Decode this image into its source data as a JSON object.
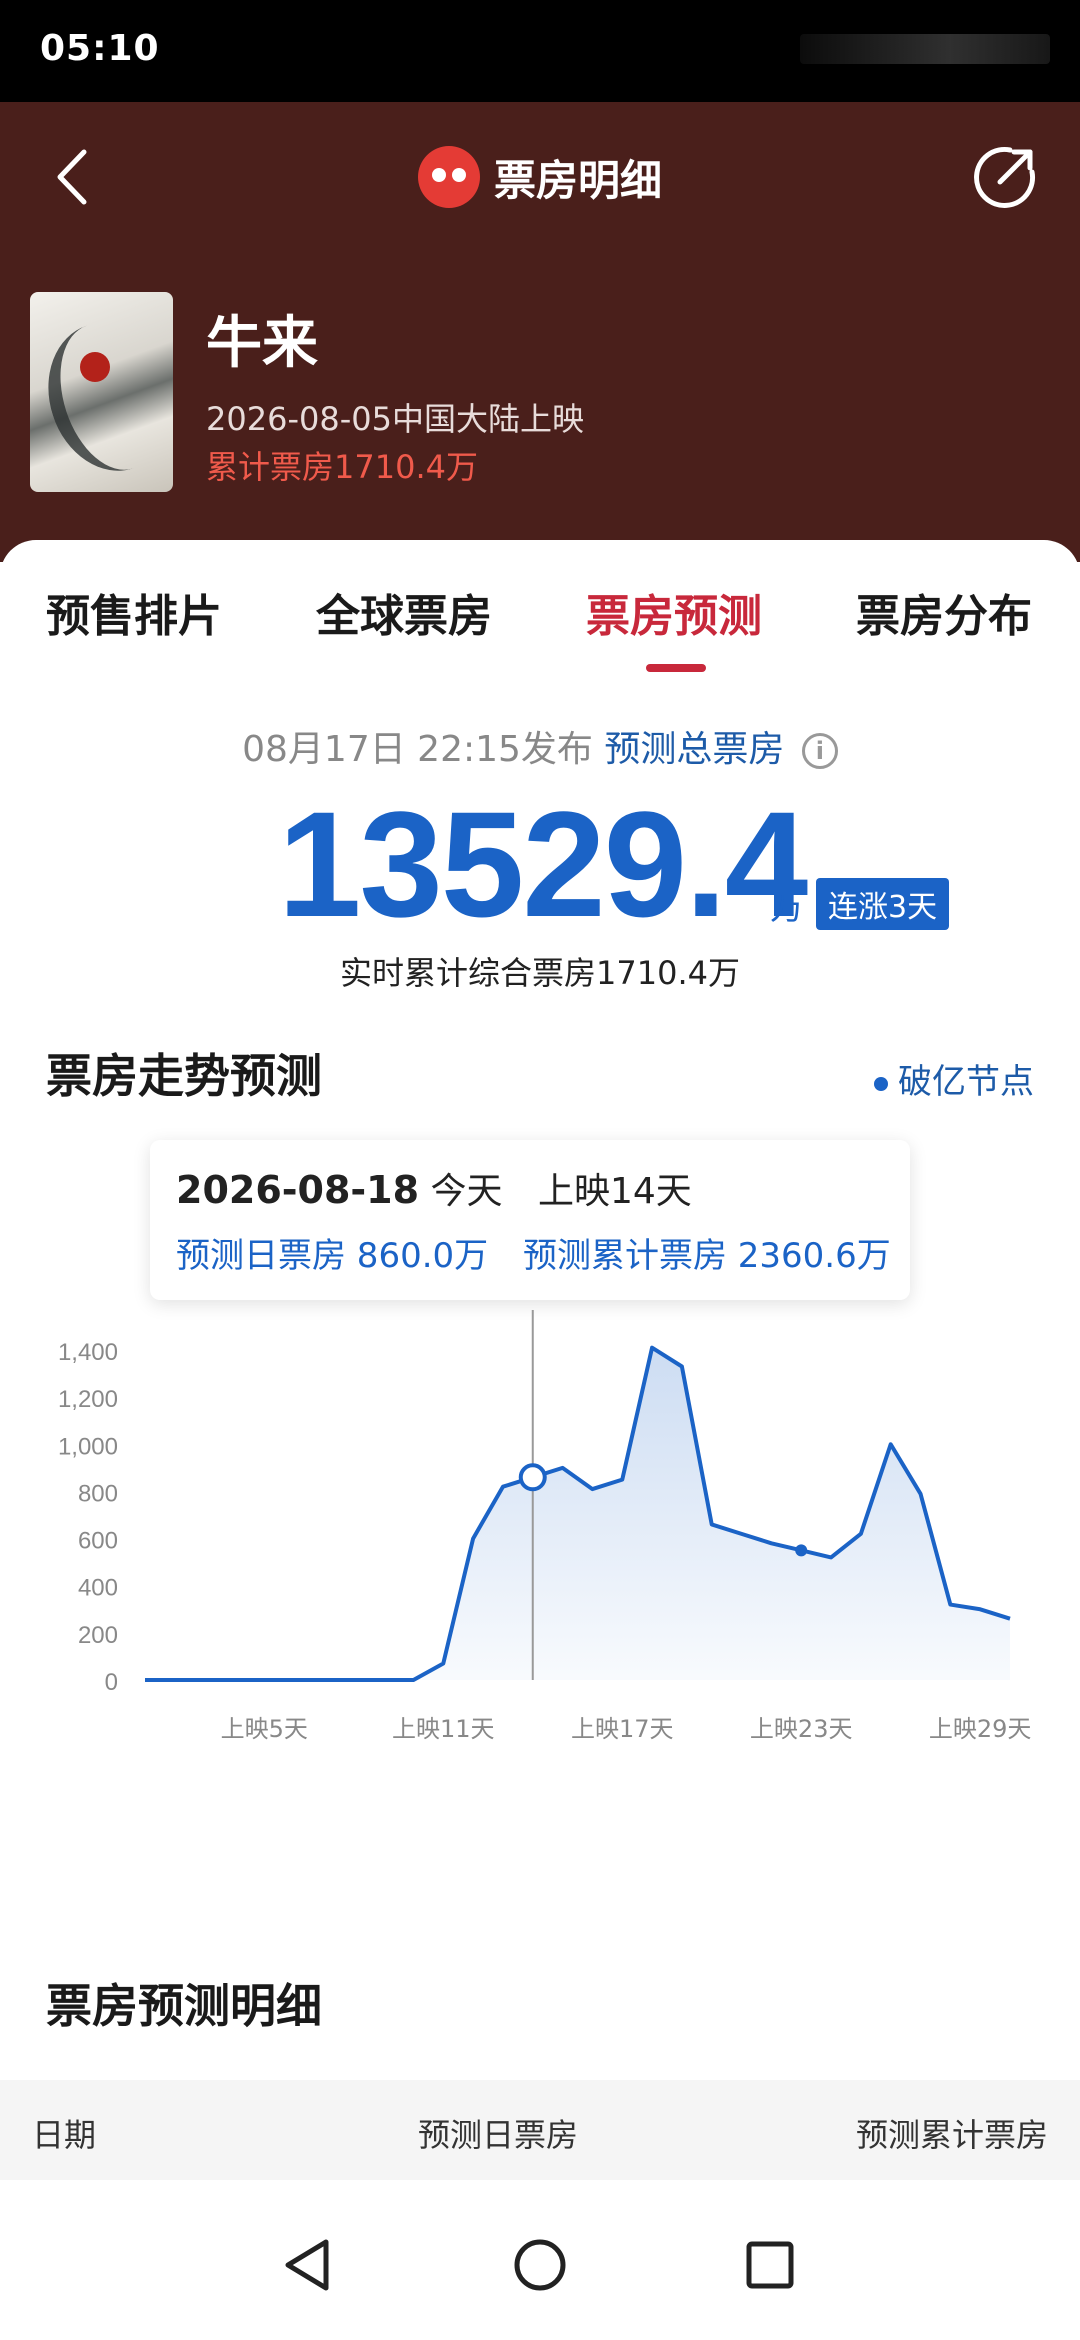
{
  "status_bar": {
    "time": "05:10"
  },
  "header": {
    "title": "票房明细",
    "back_icon": "chevron-left-icon",
    "share_icon": "share-icon",
    "logo_icon": "maoyan-cat-logo"
  },
  "movie": {
    "name": "牛来",
    "release": "2026-08-05中国大陆上映",
    "cumulative_box": "累计票房1710.4万"
  },
  "tabs": [
    {
      "label": "预售排片",
      "active": false
    },
    {
      "label": "全球票房",
      "active": false
    },
    {
      "label": "票房预测",
      "active": true
    },
    {
      "label": "票房分布",
      "active": false
    }
  ],
  "forecast": {
    "published": "08月17日 22:15发布",
    "total_label": "预测总票房",
    "total_value": "13529.4",
    "unit": "万",
    "badge": "连涨3天",
    "realtime": "实时累计综合票房1710.4万"
  },
  "trend": {
    "title": "票房走势预测",
    "legend": "破亿节点",
    "tooltip": {
      "date": "2026-08-18",
      "today": "今天",
      "days": "上映14天",
      "daily": "预测日票房 860.0万",
      "cumulative": "预测累计票房 2360.6万"
    }
  },
  "chart_data": {
    "type": "area",
    "y_ticks": [
      "1,400",
      "1,200",
      "1,000",
      "800",
      "600",
      "400",
      "200",
      "0"
    ],
    "x_ticks": [
      "上映5天",
      "上映11天",
      "上映17天",
      "上映23天",
      "上映29天"
    ],
    "ylim": [
      0,
      1400
    ],
    "x": [
      1,
      2,
      3,
      4,
      5,
      6,
      7,
      8,
      9,
      10,
      11,
      12,
      13,
      14,
      15,
      16,
      17,
      18,
      19,
      20,
      21,
      22,
      23,
      24,
      25,
      26,
      27,
      28,
      29,
      30
    ],
    "values": [
      0,
      0,
      0,
      0,
      0,
      0,
      0,
      0,
      0,
      0,
      70,
      600,
      820,
      860,
      900,
      810,
      850,
      1410,
      1330,
      660,
      620,
      580,
      550,
      520,
      620,
      1000,
      790,
      320,
      300,
      260
    ],
    "highlight_x": 14,
    "color": "#1b63c6",
    "fill": "#e6eefb"
  },
  "detail": {
    "title": "票房预测明细",
    "columns": [
      "日期",
      "预测日票房",
      "预测累计票房"
    ]
  },
  "nav": {
    "back": "nav-back-icon",
    "home": "nav-home-icon",
    "recents": "nav-recents-icon"
  }
}
